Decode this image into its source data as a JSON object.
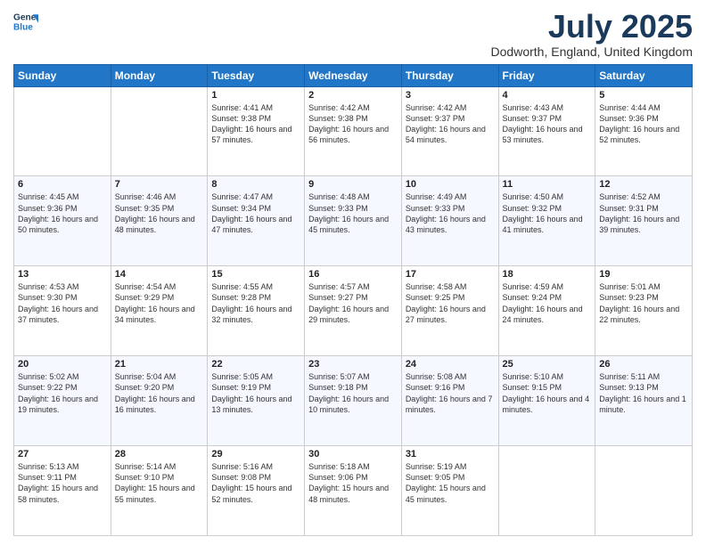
{
  "header": {
    "logo_line1": "General",
    "logo_line2": "Blue",
    "month": "July 2025",
    "location": "Dodworth, England, United Kingdom"
  },
  "weekdays": [
    "Sunday",
    "Monday",
    "Tuesday",
    "Wednesday",
    "Thursday",
    "Friday",
    "Saturday"
  ],
  "weeks": [
    [
      {
        "day": "",
        "info": ""
      },
      {
        "day": "",
        "info": ""
      },
      {
        "day": "1",
        "info": "Sunrise: 4:41 AM\nSunset: 9:38 PM\nDaylight: 16 hours and 57 minutes."
      },
      {
        "day": "2",
        "info": "Sunrise: 4:42 AM\nSunset: 9:38 PM\nDaylight: 16 hours and 56 minutes."
      },
      {
        "day": "3",
        "info": "Sunrise: 4:42 AM\nSunset: 9:37 PM\nDaylight: 16 hours and 54 minutes."
      },
      {
        "day": "4",
        "info": "Sunrise: 4:43 AM\nSunset: 9:37 PM\nDaylight: 16 hours and 53 minutes."
      },
      {
        "day": "5",
        "info": "Sunrise: 4:44 AM\nSunset: 9:36 PM\nDaylight: 16 hours and 52 minutes."
      }
    ],
    [
      {
        "day": "6",
        "info": "Sunrise: 4:45 AM\nSunset: 9:36 PM\nDaylight: 16 hours and 50 minutes."
      },
      {
        "day": "7",
        "info": "Sunrise: 4:46 AM\nSunset: 9:35 PM\nDaylight: 16 hours and 48 minutes."
      },
      {
        "day": "8",
        "info": "Sunrise: 4:47 AM\nSunset: 9:34 PM\nDaylight: 16 hours and 47 minutes."
      },
      {
        "day": "9",
        "info": "Sunrise: 4:48 AM\nSunset: 9:33 PM\nDaylight: 16 hours and 45 minutes."
      },
      {
        "day": "10",
        "info": "Sunrise: 4:49 AM\nSunset: 9:33 PM\nDaylight: 16 hours and 43 minutes."
      },
      {
        "day": "11",
        "info": "Sunrise: 4:50 AM\nSunset: 9:32 PM\nDaylight: 16 hours and 41 minutes."
      },
      {
        "day": "12",
        "info": "Sunrise: 4:52 AM\nSunset: 9:31 PM\nDaylight: 16 hours and 39 minutes."
      }
    ],
    [
      {
        "day": "13",
        "info": "Sunrise: 4:53 AM\nSunset: 9:30 PM\nDaylight: 16 hours and 37 minutes."
      },
      {
        "day": "14",
        "info": "Sunrise: 4:54 AM\nSunset: 9:29 PM\nDaylight: 16 hours and 34 minutes."
      },
      {
        "day": "15",
        "info": "Sunrise: 4:55 AM\nSunset: 9:28 PM\nDaylight: 16 hours and 32 minutes."
      },
      {
        "day": "16",
        "info": "Sunrise: 4:57 AM\nSunset: 9:27 PM\nDaylight: 16 hours and 29 minutes."
      },
      {
        "day": "17",
        "info": "Sunrise: 4:58 AM\nSunset: 9:25 PM\nDaylight: 16 hours and 27 minutes."
      },
      {
        "day": "18",
        "info": "Sunrise: 4:59 AM\nSunset: 9:24 PM\nDaylight: 16 hours and 24 minutes."
      },
      {
        "day": "19",
        "info": "Sunrise: 5:01 AM\nSunset: 9:23 PM\nDaylight: 16 hours and 22 minutes."
      }
    ],
    [
      {
        "day": "20",
        "info": "Sunrise: 5:02 AM\nSunset: 9:22 PM\nDaylight: 16 hours and 19 minutes."
      },
      {
        "day": "21",
        "info": "Sunrise: 5:04 AM\nSunset: 9:20 PM\nDaylight: 16 hours and 16 minutes."
      },
      {
        "day": "22",
        "info": "Sunrise: 5:05 AM\nSunset: 9:19 PM\nDaylight: 16 hours and 13 minutes."
      },
      {
        "day": "23",
        "info": "Sunrise: 5:07 AM\nSunset: 9:18 PM\nDaylight: 16 hours and 10 minutes."
      },
      {
        "day": "24",
        "info": "Sunrise: 5:08 AM\nSunset: 9:16 PM\nDaylight: 16 hours and 7 minutes."
      },
      {
        "day": "25",
        "info": "Sunrise: 5:10 AM\nSunset: 9:15 PM\nDaylight: 16 hours and 4 minutes."
      },
      {
        "day": "26",
        "info": "Sunrise: 5:11 AM\nSunset: 9:13 PM\nDaylight: 16 hours and 1 minute."
      }
    ],
    [
      {
        "day": "27",
        "info": "Sunrise: 5:13 AM\nSunset: 9:11 PM\nDaylight: 15 hours and 58 minutes."
      },
      {
        "day": "28",
        "info": "Sunrise: 5:14 AM\nSunset: 9:10 PM\nDaylight: 15 hours and 55 minutes."
      },
      {
        "day": "29",
        "info": "Sunrise: 5:16 AM\nSunset: 9:08 PM\nDaylight: 15 hours and 52 minutes."
      },
      {
        "day": "30",
        "info": "Sunrise: 5:18 AM\nSunset: 9:06 PM\nDaylight: 15 hours and 48 minutes."
      },
      {
        "day": "31",
        "info": "Sunrise: 5:19 AM\nSunset: 9:05 PM\nDaylight: 15 hours and 45 minutes."
      },
      {
        "day": "",
        "info": ""
      },
      {
        "day": "",
        "info": ""
      }
    ]
  ]
}
